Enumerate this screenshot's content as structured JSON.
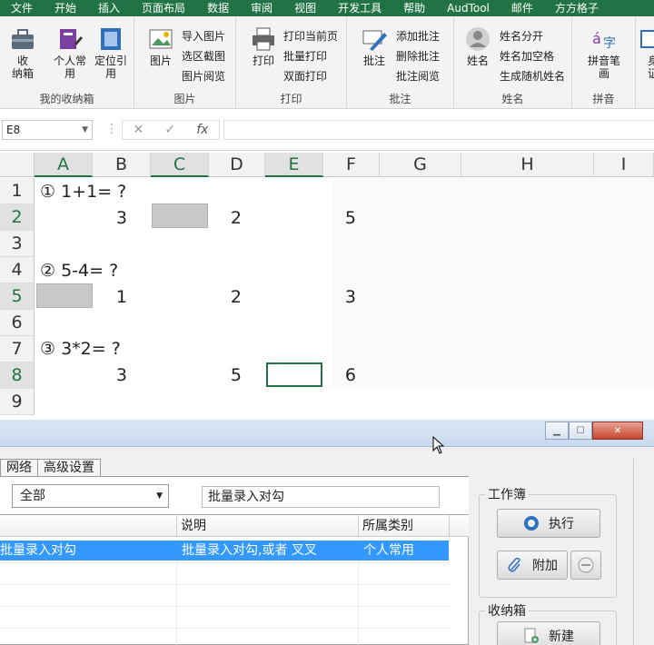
{
  "ribbon_tabs": [
    "文件",
    "开始",
    "插入",
    "页面布局",
    "数据",
    "审阅",
    "视图",
    "开发工具",
    "帮助",
    "AudTool",
    "邮件",
    "方方格子"
  ],
  "ribbon": {
    "group_box": {
      "label": "我的收纳箱",
      "btn_collect": "收\n纳箱",
      "btn_personal": "个人常\n用",
      "btn_locate": "定位引\n用"
    },
    "group_picture": {
      "label": "图片",
      "btn_picture": "图片",
      "import": "导入图片",
      "screenshot": "选区截图",
      "browse": "图片阅览"
    },
    "group_print": {
      "label": "打印",
      "btn_print": "打印",
      "current": "打印当前页",
      "batch": "批量打印",
      "duplex": "双面打印"
    },
    "group_comment": {
      "label": "批注",
      "btn_comment": "批注",
      "add": "添加批注",
      "delete": "删除批注",
      "browse": "批注阅览"
    },
    "group_name": {
      "label": "姓名",
      "btn_name": "姓名",
      "split": "姓名分开",
      "space": "姓名加空格",
      "random": "生成随机姓名"
    },
    "group_pinyin": {
      "label": "拼音",
      "btn_pinyin": "拼音笔\n画"
    },
    "group_id": {
      "btn_id": "身\n证"
    }
  },
  "formula_bar": {
    "name_box": "E8",
    "cancel_icon": "✕",
    "confirm_icon": "✓",
    "fx": "fx",
    "formula": ""
  },
  "columns": [
    "A",
    "B",
    "C",
    "D",
    "E",
    "F",
    "G",
    "H",
    "I"
  ],
  "rows": [
    "1",
    "2",
    "3",
    "4",
    "5",
    "6",
    "7",
    "8",
    "9"
  ],
  "cells": {
    "A1": "① 1+1= ?",
    "B2": "3",
    "D2": "2",
    "F2": "5",
    "A4": "② 5-4= ?",
    "B5": "1",
    "D5": "2",
    "F5": "3",
    "A7": "③ 3*2= ?",
    "B8": "3",
    "D8": "5",
    "F8": "6"
  },
  "dialog": {
    "tabs": [
      "网络",
      "高级设置"
    ],
    "category_select": "全部",
    "search_text": "批量录入对勾",
    "list_headers": [
      "",
      "说明",
      "所属类别"
    ],
    "list_rows": [
      {
        "name": "批量录入对勾",
        "desc": "批量录入对勾,或者 叉叉",
        "category": "个人常用"
      }
    ],
    "workbook_label": "工作簿",
    "execute_label": "执行",
    "attach_label": "附加",
    "box_label": "收纳箱",
    "new_label": "新建"
  },
  "colors": {
    "ribbon_green": "#217346",
    "selection_blue": "#3399ff",
    "selected_cell_border": "#217346"
  }
}
